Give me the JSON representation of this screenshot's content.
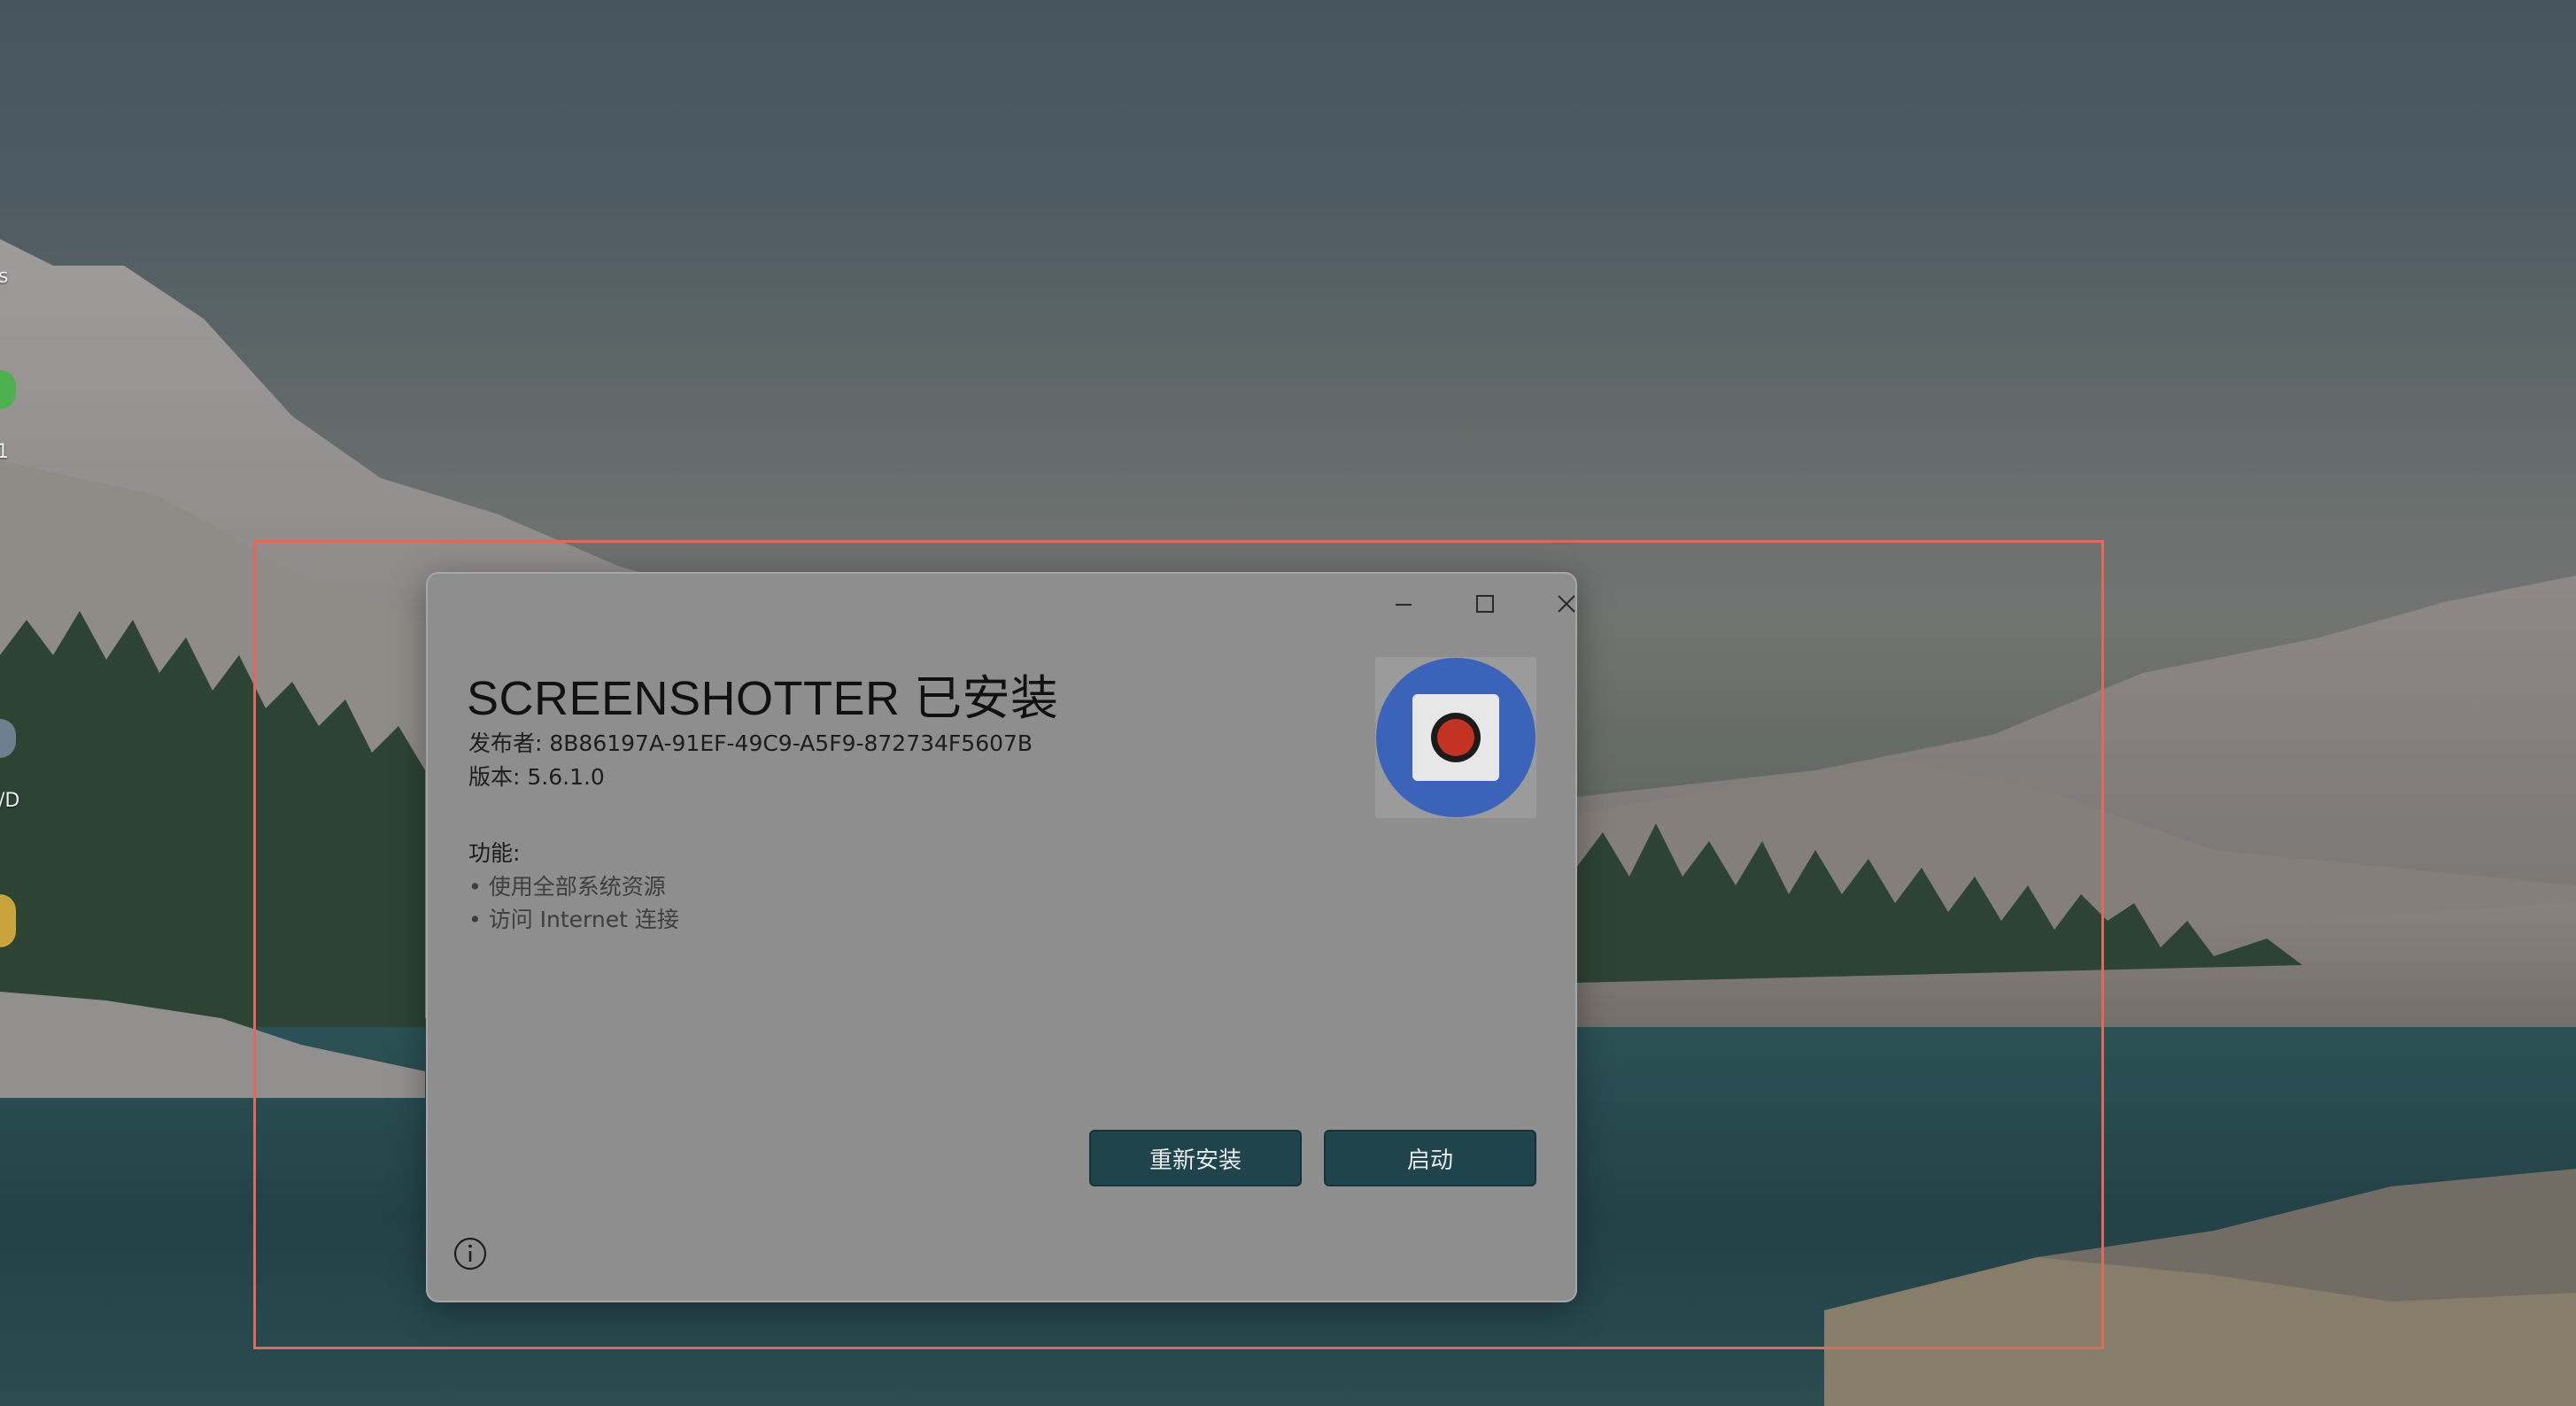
{
  "window": {
    "minimize_icon": "minimize-icon",
    "maximize_icon": "maximize-icon",
    "close_icon": "close-icon"
  },
  "installer": {
    "title": "SCREENSHOTTER 已安装",
    "publisher": "发布者: 8B86197A-91EF-49C9-A5F9-872734F5607B",
    "version": "版本: 5.6.1.0",
    "capabilities_heading": "功能:",
    "capabilities": [
      "• 使用全部系统资源",
      "• 访问 Internet 连接"
    ],
    "reinstall_label": "重新安装",
    "launch_label": "启动",
    "app_icon": "record-icon",
    "info_icon": "info-icon"
  },
  "desktop": {
    "edge_labels": [
      "s",
      "1",
      "/D"
    ]
  },
  "colors": {
    "selection_border": "#e4675a",
    "dialog_background": "#8e8e8e",
    "button_background": "#1f444c",
    "icon_blue": "#3a63b9",
    "icon_red": "#c43222"
  }
}
